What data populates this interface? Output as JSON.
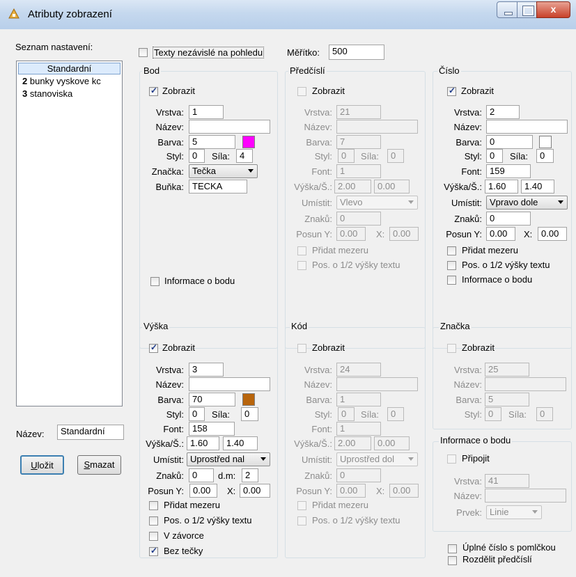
{
  "window": {
    "title": "Atributy zobrazení",
    "close_glyph": "x"
  },
  "left": {
    "list_label": "Seznam nastavení:",
    "items": [
      {
        "num": "",
        "text": "Standardní"
      },
      {
        "num": "2",
        "text": "bunky vyskove kc"
      },
      {
        "num": "3",
        "text": "stanoviska"
      }
    ],
    "name_label": "Název:",
    "name_value": "Standardní",
    "save_label_u": "U",
    "save_label_rest": "ložit",
    "delete_label_u": "S",
    "delete_label_rest": "mazat"
  },
  "top": {
    "texty_label": "Texty nezávislé na pohledu",
    "meritko_label": "Měřítko:",
    "meritko_value": "500"
  },
  "bod": {
    "title": "Bod",
    "zobrazit": "Zobrazit",
    "vrstva_label": "Vrstva:",
    "vrstva": "1",
    "nazev_label": "Název:",
    "nazev": "",
    "barva_label": "Barva:",
    "barva": "5",
    "barva_color": "#ff00ff",
    "styl_label": "Styl:",
    "styl": "0",
    "sila_label": "Síla:",
    "sila": "4",
    "znacka_label": "Značka:",
    "znacka": "Tečka",
    "bunka_label": "Buňka:",
    "bunka": "TECKA",
    "info": "Informace o bodu"
  },
  "predcisli": {
    "title": "Předčíslí",
    "zobrazit": "Zobrazit",
    "vrstva_label": "Vrstva:",
    "vrstva": "21",
    "nazev_label": "Název:",
    "nazev": "",
    "barva_label": "Barva:",
    "barva": "7",
    "styl_label": "Styl:",
    "styl": "0",
    "sila_label": "Síla:",
    "sila": "0",
    "font_label": "Font:",
    "font": "1",
    "vyska_label": "Výška/Š.:",
    "vyska": "2.00",
    "sirka": "0.00",
    "umistit_label": "Umístit:",
    "umistit": "Vlevo",
    "znaku_label": "Znaků:",
    "znaku": "0",
    "posun_label": "Posun Y:",
    "posun_y": "0.00",
    "x_label": "X:",
    "posun_x": "0.00",
    "pridat": "Přidat mezeru",
    "pos": "Pos. o 1/2 výšky textu"
  },
  "cislo": {
    "title": "Číslo",
    "zobrazit": "Zobrazit",
    "vrstva_label": "Vrstva:",
    "vrstva": "2",
    "nazev_label": "Název:",
    "nazev": "",
    "barva_label": "Barva:",
    "barva": "0",
    "barva_color": "#ffffff",
    "styl_label": "Styl:",
    "styl": "0",
    "sila_label": "Síla:",
    "sila": "0",
    "font_label": "Font:",
    "font": "159",
    "vyska_label": "Výška/Š.:",
    "vyska": "1.60",
    "sirka": "1.40",
    "umistit_label": "Umístit:",
    "umistit": "Vpravo dole",
    "znaku_label": "Znaků:",
    "znaku": "0",
    "posun_label": "Posun Y:",
    "posun_y": "0.00",
    "x_label": "X:",
    "posun_x": "0.00",
    "pridat": "Přidat mezeru",
    "pos": "Pos. o 1/2 výšky textu",
    "info": "Informace o bodu"
  },
  "vyska": {
    "title": "Výška",
    "zobrazit": "Zobrazit",
    "vrstva_label": "Vrstva:",
    "vrstva": "3",
    "nazev_label": "Název:",
    "nazev": "",
    "barva_label": "Barva:",
    "barva": "70",
    "barva_color": "#b8650c",
    "styl_label": "Styl:",
    "styl": "0",
    "sila_label": "Síla:",
    "sila": "0",
    "font_label": "Font:",
    "font": "158",
    "vyska_label": "Výška/Š.:",
    "vyska": "1.60",
    "sirka": "1.40",
    "umistit_label": "Umístit:",
    "umistit": "Uprostřed nal",
    "znaku_label": "Znaků:",
    "znaku": "0",
    "dm_label": "d.m:",
    "dm": "2",
    "posun_label": "Posun Y:",
    "posun_y": "0.00",
    "x_label": "X:",
    "posun_x": "0.00",
    "pridat": "Přidat mezeru",
    "pos": "Pos. o 1/2 výšky textu",
    "zavorce": "V závorce",
    "bez": "Bez tečky"
  },
  "kod": {
    "title": "Kód",
    "zobrazit": "Zobrazit",
    "vrstva_label": "Vrstva:",
    "vrstva": "24",
    "nazev_label": "Název:",
    "nazev": "",
    "barva_label": "Barva:",
    "barva": "1",
    "styl_label": "Styl:",
    "styl": "0",
    "sila_label": "Síla:",
    "sila": "0",
    "font_label": "Font:",
    "font": "1",
    "vyska_label": "Výška/Š.:",
    "vyska": "2.00",
    "sirka": "0.00",
    "umistit_label": "Umístit:",
    "umistit": "Uprostřed dol",
    "znaku_label": "Znaků:",
    "znaku": "0",
    "posun_label": "Posun Y:",
    "posun_y": "0.00",
    "x_label": "X:",
    "posun_x": "0.00",
    "pridat": "Přidat mezeru",
    "pos": "Pos. o 1/2 výšky textu"
  },
  "znacka": {
    "title": "Značka",
    "zobrazit": "Zobrazit",
    "vrstva_label": "Vrstva:",
    "vrstva": "25",
    "nazev_label": "Název:",
    "nazev": "",
    "barva_label": "Barva:",
    "barva": "5",
    "styl_label": "Styl:",
    "styl": "0",
    "sila_label": "Síla:",
    "sila": "0"
  },
  "info": {
    "title": "Informace o bodu",
    "pripojit": "Připojit",
    "vrstva_label": "Vrstva:",
    "vrstva": "41",
    "nazev_label": "Název:",
    "nazev": "",
    "prvek_label": "Prvek:",
    "prvek": "Linie"
  },
  "bottom": {
    "uplne": "Úplné číslo s pomlčkou",
    "rozdelit": "Rozdělit předčíslí"
  }
}
